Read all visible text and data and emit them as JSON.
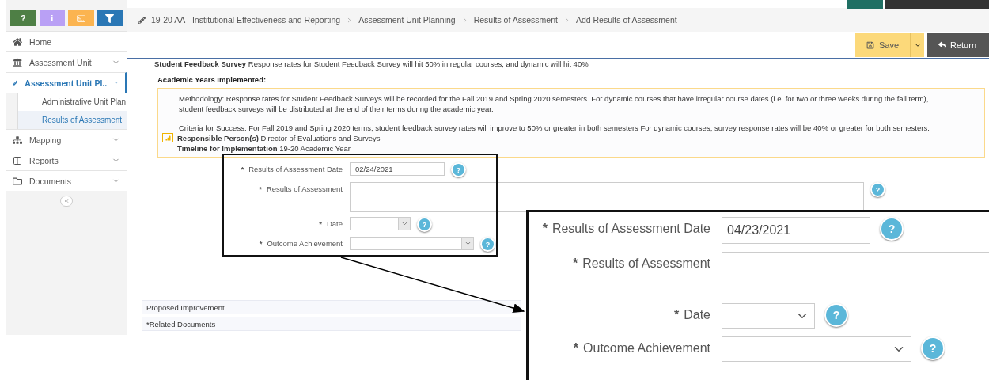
{
  "toolbar_buttons": [
    {
      "kind": "help",
      "label": "?",
      "color": "#4e7f45"
    },
    {
      "kind": "info",
      "label": "i",
      "color": "#b9a0f5"
    },
    {
      "kind": "card",
      "color": "#fbb450"
    },
    {
      "kind": "filter",
      "color": "#2a77b5"
    }
  ],
  "sidebar": {
    "items": [
      {
        "kind": "home",
        "label": "Home",
        "selected": false
      },
      {
        "kind": "bank",
        "label": "Assessment Unit",
        "selected": false,
        "expanded": false
      },
      {
        "kind": "pencil",
        "label": "Assessment Unit Pl..",
        "selected": true,
        "expanded": true,
        "children": [
          {
            "label": "Administrative Unit Plan",
            "selected": false
          },
          {
            "label": "Results of Assessment",
            "selected": true
          }
        ]
      },
      {
        "kind": "sitemap",
        "label": "Mapping",
        "selected": false,
        "expanded": false
      },
      {
        "kind": "columns",
        "label": "Reports",
        "selected": false,
        "expanded": false
      },
      {
        "kind": "folder",
        "label": "Documents",
        "selected": false,
        "expanded": false
      }
    ]
  },
  "breadcrumb": [
    "19-20 AA - Institutional Effectiveness and Reporting",
    "Assessment Unit Planning",
    "Results of Assessment",
    "Add Results of Assessment"
  ],
  "buttons": [
    {
      "kind": "save",
      "label": "Save"
    },
    {
      "kind": "return",
      "label": "Return"
    }
  ],
  "survey": {
    "title": "Student Feedback Survey",
    "text": "Response rates for Student Feedback Survey will hit 50% in regular courses, and dynamic will hit 40%"
  },
  "section_heading": "Academic Years Implemented:",
  "info_box": {
    "methodology": "Methodology: Response rates for Student Feedback Surveys will be recorded for the Fall 2019 and Spring 2020 semesters. For dynamic courses that have irregular course dates (i.e. for two or three weeks during the fall term), student feedback surveys will be distributed at the end  of their terms during the academic year.",
    "criteria": "Criteria for Success: For Fall 2019 and Spring 2020  terms, student feedback survey rates will improve to 50% or greater in both semesters  For dynamic courses, survey response rates will be 40% or greater for both semesters.",
    "details": [
      "**Responsible Person(s)** Director of Evaluations and Surveys",
      "**Timeline for Implementation** 19-20 Academic Year"
    ]
  },
  "form": {
    "fields": [
      {
        "kind": "input",
        "required_mark": "*",
        "label": "Results of Assessment Date",
        "value": "02/24/2021",
        "help": "?"
      },
      {
        "kind": "textarea",
        "required_mark": "*",
        "label": "Results of Assessment",
        "help": "?"
      },
      {
        "kind": "select",
        "required_mark": "*",
        "label": "Date",
        "help": "?"
      },
      {
        "kind": "select",
        "required_mark": "*",
        "label": "Outcome Achievement",
        "help": "?"
      }
    ]
  },
  "panels": [
    "Proposed Improvement",
    "*Related Documents"
  ],
  "callout": {
    "fields": [
      {
        "kind": "input",
        "required_mark": "*",
        "label": "Results of Assessment Date",
        "value": "04/23/2021",
        "help": "?"
      },
      {
        "kind": "textarea",
        "required_mark": "*",
        "label": "Results of Assessment"
      },
      {
        "kind": "select",
        "required_mark": "*",
        "label": "Date",
        "help": "?"
      },
      {
        "kind": "select",
        "required_mark": "*",
        "label": "Outcome Achievement",
        "help": "?"
      }
    ]
  }
}
